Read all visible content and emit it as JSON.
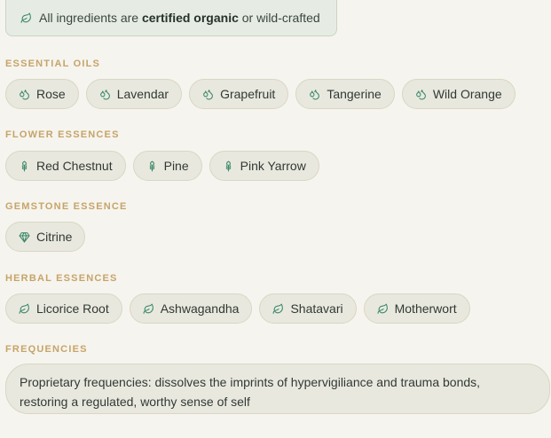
{
  "banner": {
    "icon": "leaf-icon",
    "prefix": "All ingredients are ",
    "emphasis": "certified organic",
    "suffix": " or wild-crafted"
  },
  "sections": {
    "essential_oils": {
      "title": "ESSENTIAL OILS",
      "icon": "droplets-icon",
      "items": [
        "Rose",
        "Lavendar",
        "Grapefruit",
        "Tangerine",
        "Wild Orange"
      ]
    },
    "flower_essences": {
      "title": "FLOWER ESSENCES",
      "icon": "flower-icon",
      "items": [
        "Red Chestnut",
        "Pine",
        "Pink Yarrow"
      ]
    },
    "gemstone_essence": {
      "title": "GEMSTONE ESSENCE",
      "icon": "gem-icon",
      "items": [
        "Citrine"
      ]
    },
    "herbal_essences": {
      "title": "HERBAL ESSENCES",
      "icon": "leaf-icon",
      "items": [
        "Licorice Root",
        "Ashwagandha",
        "Shatavari",
        "Motherwort"
      ]
    },
    "frequencies": {
      "title": "FREQUENCIES",
      "text": "Proprietary frequencies: dissolves the imprints of hypervigiliance and trauma bonds, restoring a regulated, worthy sense of self"
    }
  },
  "colors": {
    "icon_green": "#3c8a6a",
    "section_title": "#c6a46a",
    "chip_bg": "#e9e8df",
    "banner_bg": "#e6ece3"
  }
}
